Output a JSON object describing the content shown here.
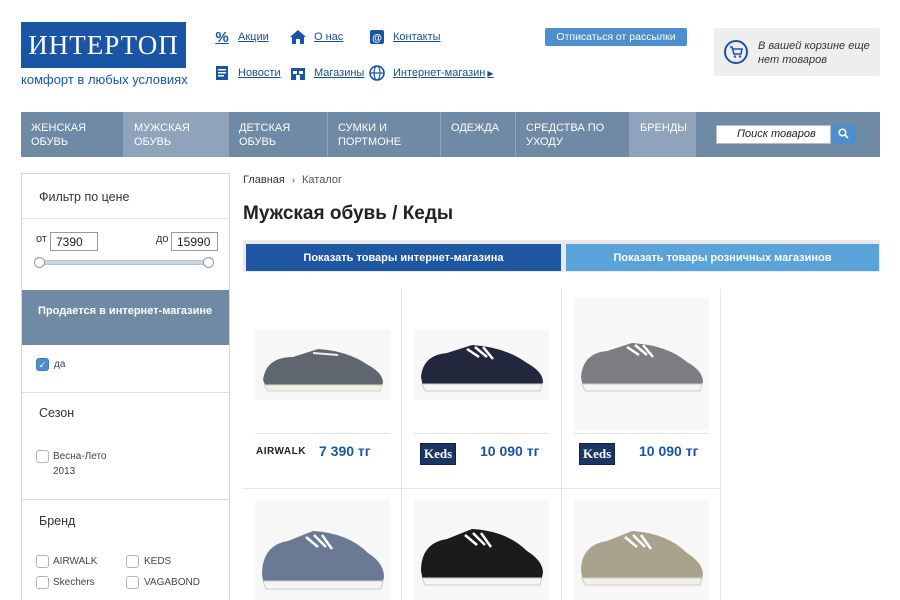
{
  "header": {
    "logo_text": "ИНТЕРТОП",
    "tagline": "комфорт в любых условиях",
    "links": [
      {
        "label": "Акции",
        "icon": "percent-icon"
      },
      {
        "label": "О нас",
        "icon": "home-icon"
      },
      {
        "label": "Контакты",
        "icon": "mail-icon"
      },
      {
        "label": "Новости",
        "icon": "news-icon"
      },
      {
        "label": "Магазины",
        "icon": "store-icon"
      },
      {
        "label": "Интернет-магазин",
        "icon": "globe-icon"
      }
    ],
    "unsubscribe_label": "Отписаться от рассылки",
    "cart_text": "В вашей корзине еще нет товаров"
  },
  "nav": {
    "items": [
      "ЖЕНСКАЯ ОБУВЬ",
      "МУЖСКАЯ ОБУВЬ",
      "ДЕТСКАЯ ОБУВЬ",
      "СУМКИ И ПОРТМОНЕ",
      "ОДЕЖДА",
      "СРЕДСТВА ПО УХОДУ",
      "БРЕНДЫ"
    ],
    "active": "МУЖСКАЯ ОБУВЬ",
    "search_placeholder": "Поиск товаров"
  },
  "sidebar": {
    "price_filter_title": "Фильтр по цене",
    "from_label": "от",
    "to_label": "до",
    "price_from": "7390",
    "price_to": "15990",
    "online_title": "Продается в интернет-магазине",
    "online_yes": "да",
    "season_title": "Сезон",
    "season_option": "Весна-Лето 2013",
    "brand_title": "Бренд",
    "brands": [
      "AIRWALK",
      "KEDS",
      "Skechers",
      "VAGABOND"
    ]
  },
  "content": {
    "breadcrumb_home": "Главная",
    "breadcrumb_current": "Каталог",
    "title": "Мужская обувь / Кеды",
    "tab_online": "Показать товары интернет-магазина",
    "tab_retail": "Показать товары розничных магазинов",
    "products": [
      {
        "brand": "AIRWALK",
        "price": "7 390 тг",
        "color": "#5f6670"
      },
      {
        "brand": "Keds",
        "price": "10 090 тг",
        "color": "#23273d"
      },
      {
        "brand": "Keds",
        "price": "10 090 тг",
        "color": "#7b7d80"
      },
      {
        "brand": "",
        "price": "",
        "color": "#6a7994"
      },
      {
        "brand": "",
        "price": "",
        "color": "#1b1b1b"
      },
      {
        "brand": "",
        "price": "",
        "color": "#a9a38e"
      }
    ]
  }
}
